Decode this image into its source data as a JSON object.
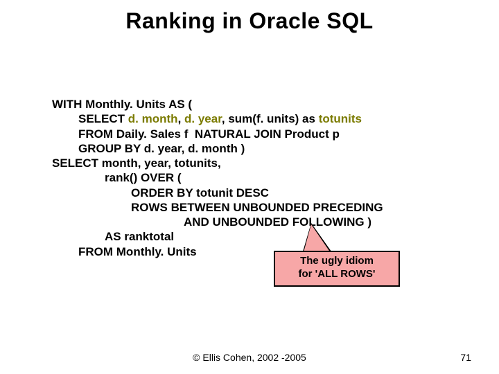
{
  "title": "Ranking in Oracle SQL",
  "code": {
    "l1a": "WITH Monthly. Units AS (",
    "l2a": "SELECT ",
    "l2b": "d. month",
    "l2c": ", ",
    "l2d": "d. year",
    "l2e": ", sum(f. units) as ",
    "l2f": "totunits",
    "l3": "FROM Daily. Sales f  NATURAL JOIN Product p",
    "l4": "GROUP BY d. year, d. month )",
    "l5": "SELECT month, year, totunits,",
    "l6": "rank() OVER (",
    "l7": "ORDER BY totunit DESC",
    "l8": "ROWS BETWEEN UNBOUNDED PRECEDING",
    "l9": "AND UNBOUNDED FOLLOWING )",
    "l10": "AS ranktotal",
    "l11": "FROM Monthly. Units"
  },
  "callout": {
    "line1": "The ugly idiom",
    "line2": "for 'ALL ROWS'"
  },
  "footer": {
    "copyright": "© Ellis Cohen, 2002 -2005",
    "page": "71"
  }
}
